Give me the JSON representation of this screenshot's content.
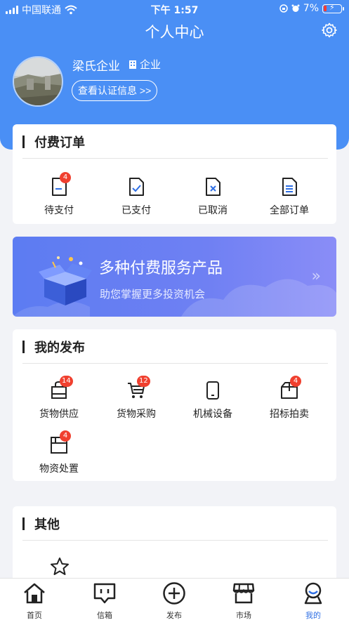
{
  "status_bar": {
    "carrier": "中国联通",
    "time": "下午 1:57",
    "battery": "7%"
  },
  "header": {
    "title": "个人中心",
    "settings_icon": "gear-icon"
  },
  "profile": {
    "name": "梁氏企业",
    "type_label": "企业",
    "verify_button": "查看认证信息 >>"
  },
  "paid_orders": {
    "title": "付费订单",
    "items": [
      {
        "label": "待支付",
        "badge": "4",
        "icon": "pending-payment-icon"
      },
      {
        "label": "已支付",
        "badge": "",
        "icon": "paid-icon"
      },
      {
        "label": "已取消",
        "badge": "",
        "icon": "cancelled-icon"
      },
      {
        "label": "全部订单",
        "badge": "",
        "icon": "all-orders-icon"
      }
    ]
  },
  "banner": {
    "title": "多种付费服务产品",
    "subtitle": "助您掌握更多投资机会"
  },
  "my_posts": {
    "title": "我的发布",
    "items": [
      {
        "label": "货物供应",
        "badge": "14",
        "icon": "bag-icon"
      },
      {
        "label": "货物采购",
        "badge": "12",
        "icon": "cart-icon"
      },
      {
        "label": "机械设备",
        "badge": "",
        "icon": "phone-device-icon"
      },
      {
        "label": "招标拍卖",
        "badge": "4",
        "icon": "box-icon"
      },
      {
        "label": "物资处置",
        "badge": "4",
        "icon": "folder-icon"
      }
    ]
  },
  "others": {
    "title": "其他",
    "items": [
      {
        "icon": "star-icon"
      }
    ]
  },
  "tabbar": {
    "tabs": [
      {
        "label": "首页",
        "icon": "home-icon"
      },
      {
        "label": "信箱",
        "icon": "mailbox-icon"
      },
      {
        "label": "发布",
        "icon": "plus-circle-icon"
      },
      {
        "label": "市场",
        "icon": "store-icon"
      },
      {
        "label": "我的",
        "icon": "profile-icon",
        "active": true
      }
    ]
  },
  "colors": {
    "primary": "#4a8ff5",
    "badge": "#f0402f",
    "active_tab": "#2f6fe4"
  }
}
